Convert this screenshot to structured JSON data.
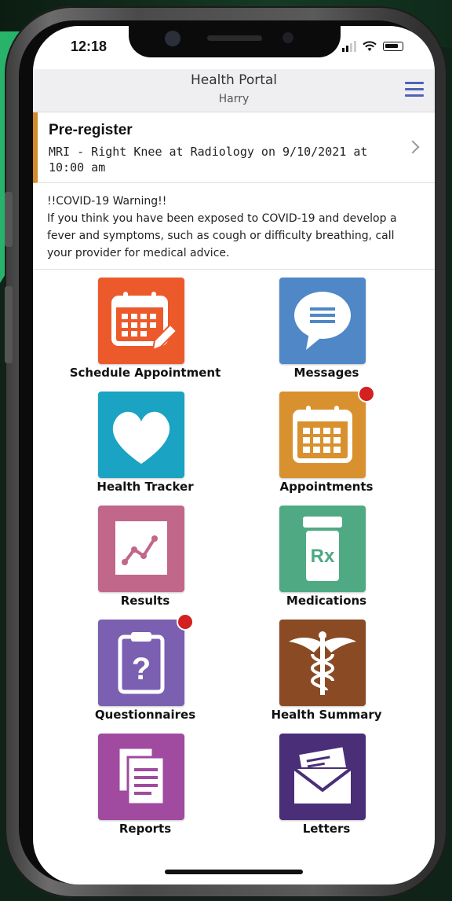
{
  "status_bar": {
    "time": "12:18"
  },
  "header": {
    "title": "Health Portal",
    "subtitle": "Harry"
  },
  "prereg": {
    "title": "Pre-register",
    "detail": "MRI - Right Knee at Radiology on 9/10/2021 at 10:00 am"
  },
  "covid": {
    "heading": "!!COVID-19 Warning!!",
    "body": "If you think you have been exposed to COVID-19 and develop a fever and symptoms, such as cough or difficulty breathing, call your provider for medical advice."
  },
  "tiles": [
    {
      "label": "Schedule Appointment",
      "color": "#ec5a2c",
      "icon": "calendar-edit-icon",
      "badge": false
    },
    {
      "label": "Messages",
      "color": "#4f87c7",
      "icon": "chat-bubble-icon",
      "badge": false
    },
    {
      "label": "Health Tracker",
      "color": "#1aa3c2",
      "icon": "heart-icon",
      "badge": false
    },
    {
      "label": "Appointments",
      "color": "#d8912e",
      "icon": "calendar-icon",
      "badge": true
    },
    {
      "label": "Results",
      "color": "#c0678a",
      "icon": "line-chart-icon",
      "badge": false
    },
    {
      "label": "Medications",
      "color": "#4faa84",
      "icon": "pill-bottle-icon",
      "badge": false
    },
    {
      "label": "Questionnaires",
      "color": "#7b5fb1",
      "icon": "clipboard-question-icon",
      "badge": true
    },
    {
      "label": "Health Summary",
      "color": "#8a4a24",
      "icon": "caduceus-icon",
      "badge": false
    },
    {
      "label": "Reports",
      "color": "#a04aa0",
      "icon": "documents-icon",
      "badge": false
    },
    {
      "label": "Letters",
      "color": "#4a2e78",
      "icon": "envelope-icon",
      "badge": false
    }
  ]
}
